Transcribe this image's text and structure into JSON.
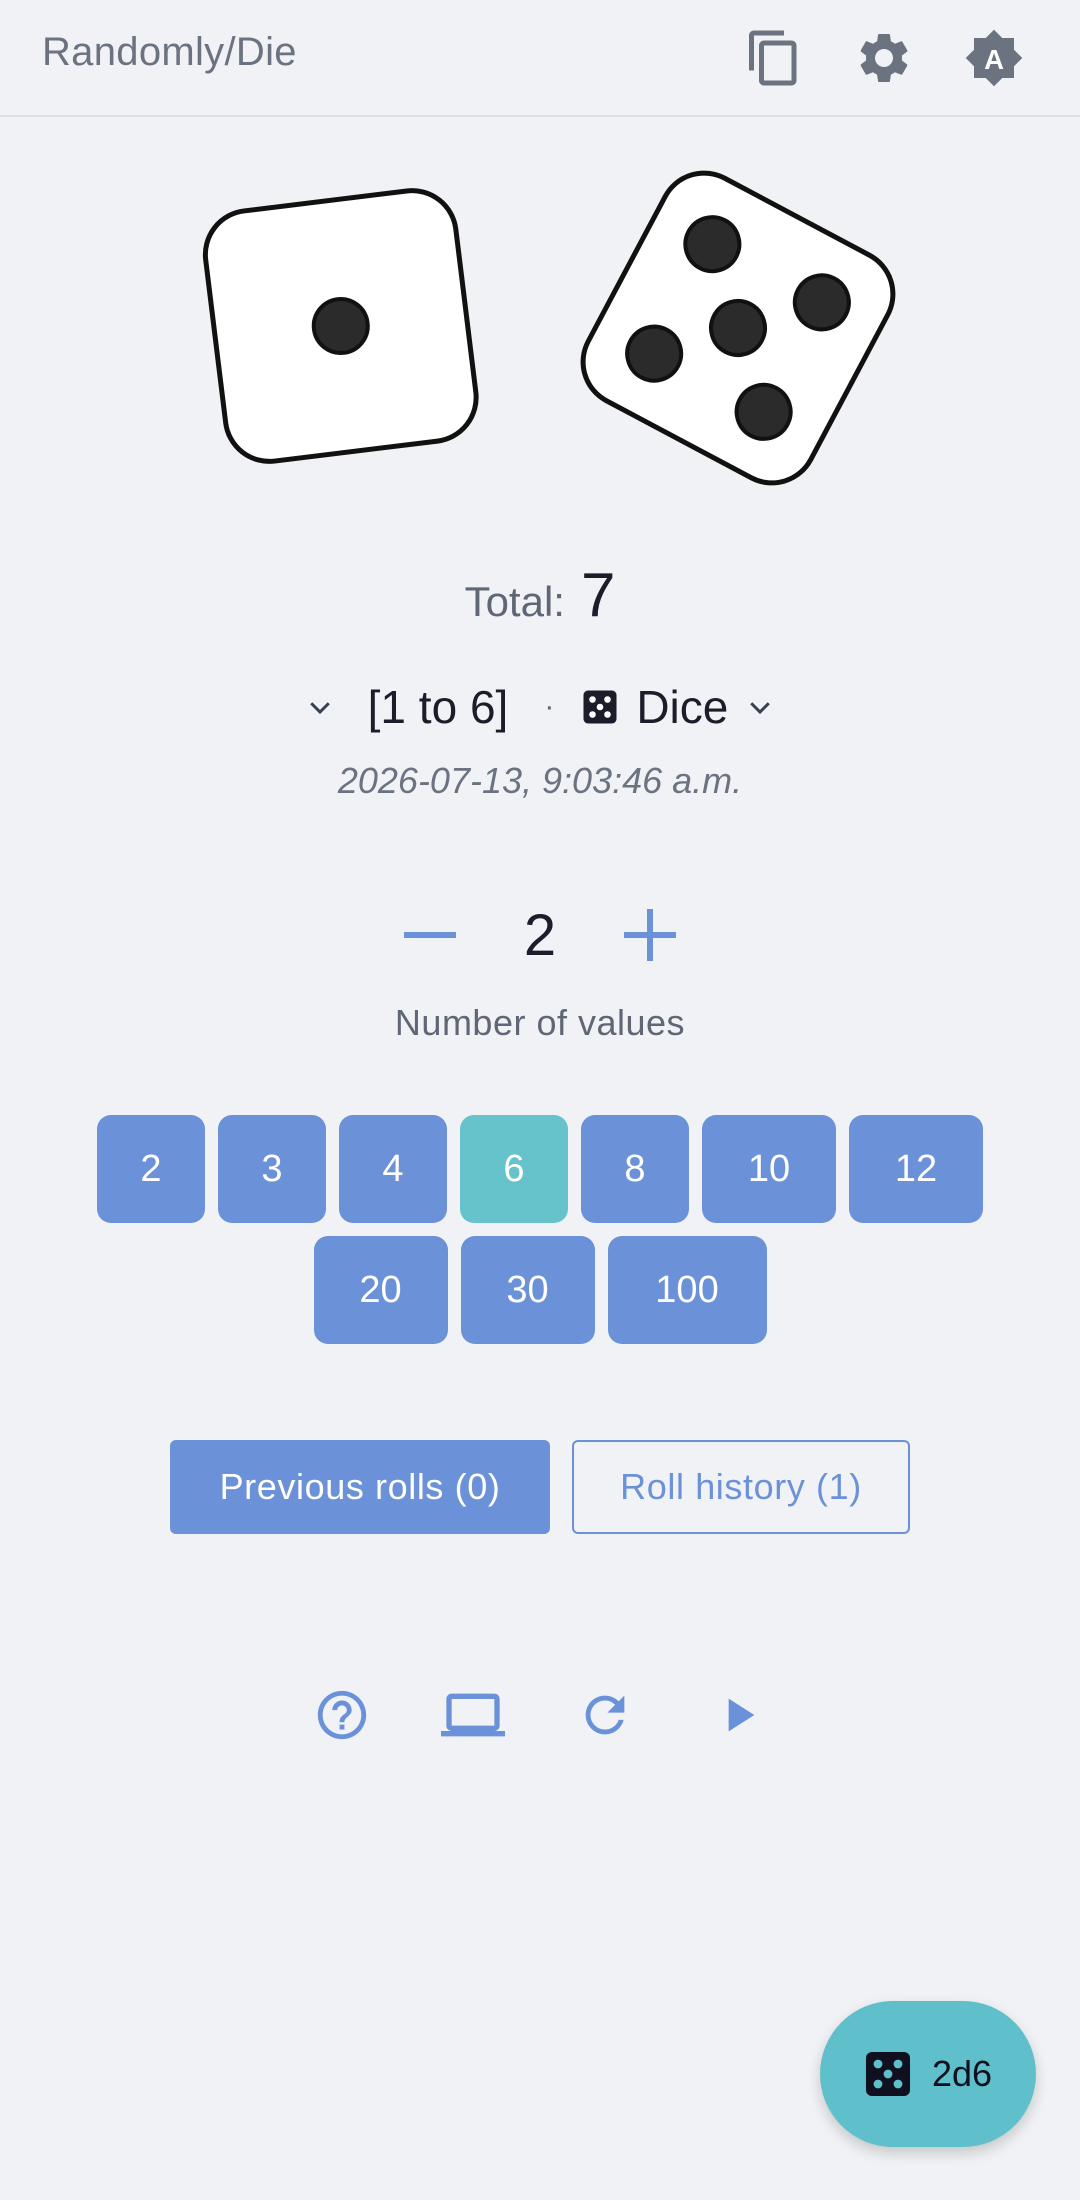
{
  "header": {
    "title": "Randomly/Die",
    "icons": [
      "copy-icon",
      "settings-icon",
      "theme-auto-icon"
    ]
  },
  "dice": {
    "faces": [
      1,
      5
    ]
  },
  "total": {
    "label": "Total:",
    "value": "7"
  },
  "range": {
    "text": "[1 to 6]",
    "separator": "·",
    "type_label": "Dice"
  },
  "timestamp": "2026-07-13, 9:03:46 a.m.",
  "stepper": {
    "value": "2",
    "label": "Number of values"
  },
  "sides": {
    "row1": [
      "2",
      "3",
      "4",
      "6",
      "8",
      "10",
      "12"
    ],
    "row2": [
      "20",
      "30",
      "100"
    ],
    "selected": "6"
  },
  "buttons": {
    "previous_rolls": "Previous rolls (0)",
    "roll_history": "Roll history (1)"
  },
  "bottom_icons": [
    "help-icon",
    "laptop-icon",
    "refresh-icon",
    "play-icon"
  ],
  "fab": {
    "label": "2d6"
  },
  "colors": {
    "accent": "#6b91d8",
    "selected_chip": "#66c2cb",
    "fab": "#5fbfcb",
    "background": "#f0f2f5"
  }
}
